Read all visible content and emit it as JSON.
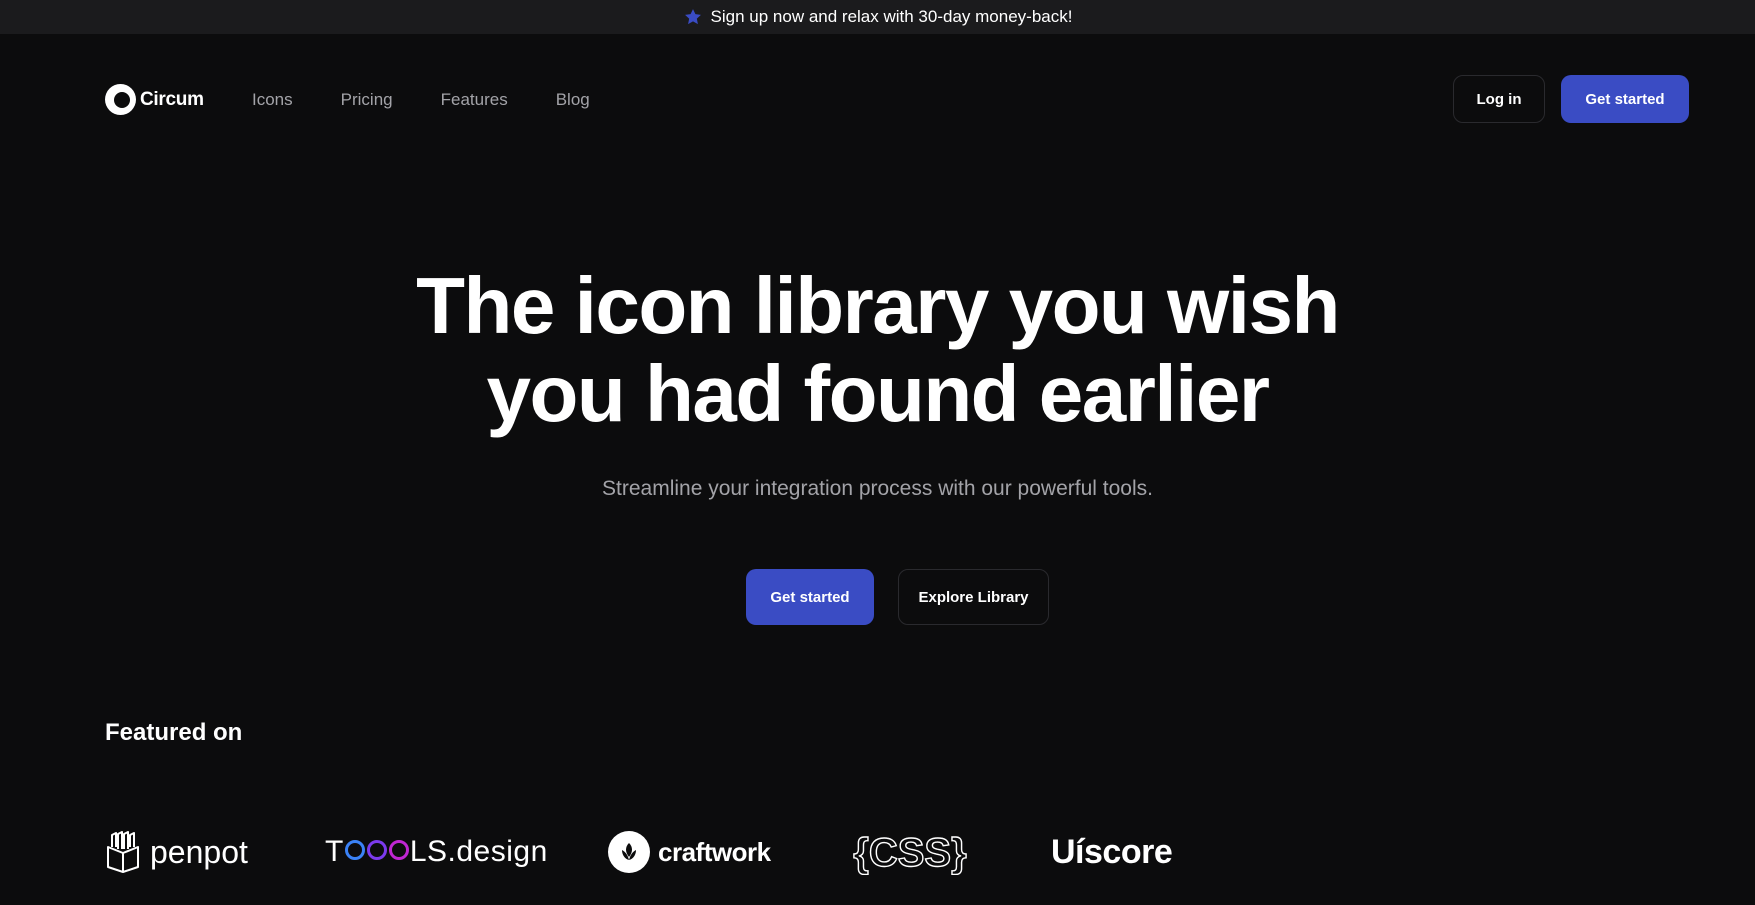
{
  "banner": {
    "icon": "star-icon",
    "text": "Sign up now and relax with 30-day money-back!"
  },
  "nav": {
    "logo_text": "Circum",
    "links": [
      "Icons",
      "Pricing",
      "Features",
      "Blog"
    ],
    "login_label": "Log in",
    "get_started_label": "Get started"
  },
  "hero": {
    "title_line1": "The icon library you wish",
    "title_line2": "you had found earlier",
    "subtitle": "Streamline your integration process with our powerful tools.",
    "primary_cta": "Get started",
    "secondary_cta": "Explore Library"
  },
  "featured": {
    "title": "Featured on",
    "brands": {
      "penpot": "penpot",
      "toools_prefix": "T",
      "toools_suffix": "LS.design",
      "craftwork": "craftwork",
      "css": "{CSS}",
      "uiscore": "Uíscore"
    }
  },
  "colors": {
    "background": "#0c0c0d",
    "banner_bg": "#1b1b1d",
    "accent": "#3a4cc4",
    "muted_text": "#a3a3a8"
  }
}
